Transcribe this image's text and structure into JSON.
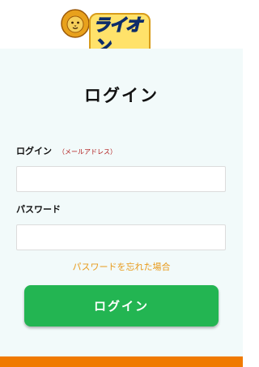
{
  "header": {
    "logo_text": "ライオン"
  },
  "login": {
    "title": "ログイン",
    "email_label": "ログイン",
    "email_hint": "（メールアドレス）",
    "email_value": "",
    "password_label": "パスワード",
    "password_value": "",
    "forgot_link": "パスワードを忘れた場合",
    "submit_label": "ログイン"
  },
  "colors": {
    "accent_green": "#23b552",
    "link_orange": "#e89a1a",
    "footer_orange": "#f07a00",
    "panel_bg": "#f2fafa"
  }
}
